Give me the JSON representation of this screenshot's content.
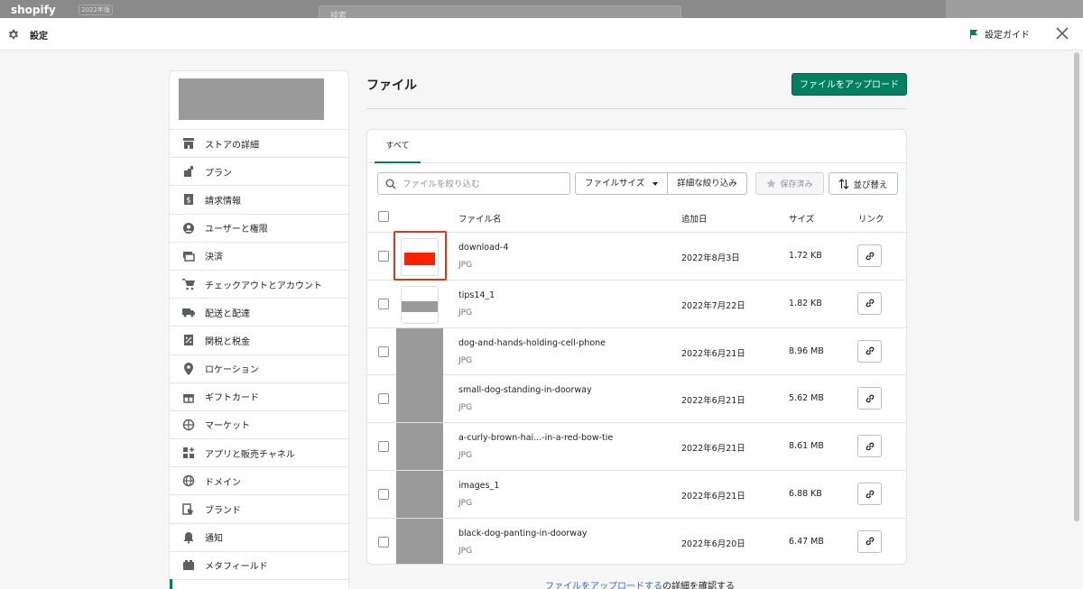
{
  "background": {
    "logo": "shopify",
    "logo_badge": "2022年版",
    "search_text": "検索"
  },
  "modal": {
    "title": "設定",
    "guide_label": "設定ガイド"
  },
  "sidebar": {
    "items": [
      {
        "label": "ストアの詳細",
        "icon": "store-icon"
      },
      {
        "label": "プラン",
        "icon": "plan-icon"
      },
      {
        "label": "請求情報",
        "icon": "billing-icon"
      },
      {
        "label": "ユーザーと権限",
        "icon": "user-icon"
      },
      {
        "label": "決済",
        "icon": "payment-icon"
      },
      {
        "label": "チェックアウトとアカウント",
        "icon": "cart-icon"
      },
      {
        "label": "配送と配達",
        "icon": "truck-icon"
      },
      {
        "label": "関税と税金",
        "icon": "tax-icon"
      },
      {
        "label": "ロケーション",
        "icon": "location-icon"
      },
      {
        "label": "ギフトカード",
        "icon": "gift-icon"
      },
      {
        "label": "マーケット",
        "icon": "globe-icon"
      },
      {
        "label": "アプリと販売チャネル",
        "icon": "apps-icon"
      },
      {
        "label": "ドメイン",
        "icon": "domain-icon"
      },
      {
        "label": "ブランド",
        "icon": "brand-icon"
      },
      {
        "label": "通知",
        "icon": "bell-icon"
      },
      {
        "label": "メタフィールド",
        "icon": "metafield-icon"
      }
    ]
  },
  "main": {
    "page_title": "ファイル",
    "upload_button": "ファイルをアップロード",
    "tabs": [
      {
        "label": "すべて"
      }
    ],
    "filter_placeholder": "ファイルを絞り込む",
    "file_size_button": "ファイルサイズ",
    "detail_filter_button": "詳細な絞り込み",
    "saved_button": "保存済み",
    "sort_button": "並び替え",
    "columns": {
      "name": "ファイル名",
      "date": "追加日",
      "size": "サイズ",
      "link": "リンク"
    },
    "files": [
      {
        "name": "download-4",
        "type": "JPG",
        "date": "2022年8月3日",
        "size": "1.72 KB",
        "thumb": "red-banner"
      },
      {
        "name": "tips14_1",
        "type": "JPG",
        "date": "2022年7月22日",
        "size": "1.82 KB",
        "thumb": "grey-banner"
      },
      {
        "name": "dog-and-hands-holding-cell-phone",
        "type": "JPG",
        "date": "2022年6月21日",
        "size": "8.96 MB",
        "thumb": "photo"
      },
      {
        "name": "small-dog-standing-in-doorway",
        "type": "JPG",
        "date": "2022年6月21日",
        "size": "5.62 MB",
        "thumb": "photo"
      },
      {
        "name": "a-curly-brown-hai...-in-a-red-bow-tie",
        "type": "JPG",
        "date": "2022年6月21日",
        "size": "8.61 MB",
        "thumb": "photo"
      },
      {
        "name": "images_1",
        "type": "JPG",
        "date": "2022年6月21日",
        "size": "6.88 KB",
        "thumb": "photo"
      },
      {
        "name": "black-dog-panting-in-doorway",
        "type": "JPG",
        "date": "2022年6月20日",
        "size": "6.47 MB",
        "thumb": "photo"
      }
    ],
    "footer_link": "ファイルをアップロードする",
    "footer_suffix": "の詳細を確認する"
  },
  "colors": {
    "primary": "#008060",
    "highlight": "#d9391a",
    "link": "#2c6ecb"
  }
}
